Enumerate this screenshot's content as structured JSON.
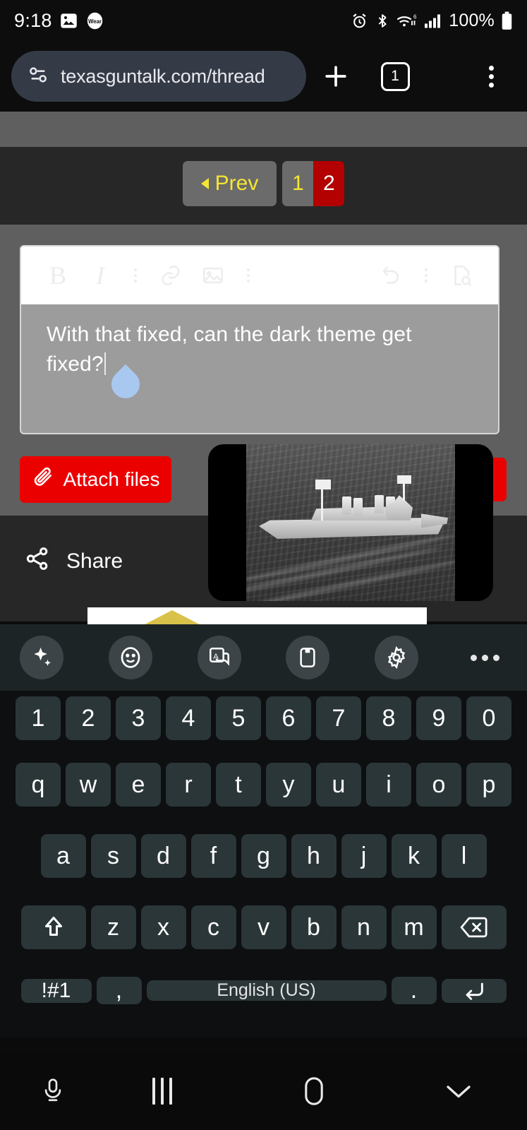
{
  "status_bar": {
    "clock": "9:18",
    "battery_percent": "100%",
    "icons": [
      "photos-icon",
      "wear-icon",
      "alarm-icon",
      "bluetooth-icon",
      "wifi-icon",
      "signal-icon",
      "battery-icon"
    ]
  },
  "browser": {
    "url": "texasguntalk.com/thread",
    "site_info_icon": "site-settings-icon",
    "new_tab_label": "+",
    "tab_count": "1",
    "menu_icon": "overflow-menu-icon"
  },
  "pagination": {
    "prev_label": "Prev",
    "pages": [
      {
        "label": "1",
        "active": false
      },
      {
        "label": "2",
        "active": true
      }
    ]
  },
  "editor": {
    "toolbar_icons": [
      "bold-icon",
      "italic-icon",
      "divider",
      "link-icon",
      "image-icon",
      "divider",
      "undo-icon",
      "divider",
      "preview-icon"
    ],
    "bold_label": "B",
    "italic_label": "I",
    "message_text": "With that fixed, can the dark theme get fixed?",
    "cursor_handle": "text-cursor-handle"
  },
  "actions": {
    "attach_label": "Attach files",
    "attach_icon": "paperclip-icon",
    "share_label": "Share",
    "share_icon": "share-icon"
  },
  "overlay_image": {
    "name": "warship-photo",
    "description": "Black and white aerial photo of a naval cruiser underway at sea"
  },
  "keyboard_toolbar": {
    "buttons": [
      {
        "name": "ai-sparkle-icon"
      },
      {
        "name": "emoji-icon"
      },
      {
        "name": "translate-icon"
      },
      {
        "name": "clipboard-icon"
      },
      {
        "name": "settings-gear-icon"
      },
      {
        "name": "more-options-icon"
      }
    ]
  },
  "keyboard": {
    "row1": [
      "1",
      "2",
      "3",
      "4",
      "5",
      "6",
      "7",
      "8",
      "9",
      "0"
    ],
    "row2": [
      "q",
      "w",
      "e",
      "r",
      "t",
      "y",
      "u",
      "i",
      "o",
      "p"
    ],
    "row3": [
      "a",
      "s",
      "d",
      "f",
      "g",
      "h",
      "j",
      "k",
      "l"
    ],
    "row4": [
      "z",
      "x",
      "c",
      "v",
      "b",
      "n",
      "m"
    ],
    "shift_icon": "shift-icon",
    "backspace_icon": "backspace-icon",
    "symbols_label": "!#1",
    "comma_label": ",",
    "space_label": "English (US)",
    "period_label": ".",
    "enter_icon": "enter-icon"
  },
  "nav_bar": {
    "mic_icon": "microphone-icon",
    "recents_icon": "recents-icon",
    "home_icon": "home-icon",
    "dismiss_icon": "dismiss-keyboard-icon"
  },
  "colors": {
    "accent_red": "#eb0000",
    "page_active_red": "#b30000",
    "link_yellow": "#f5e632",
    "editor_body_gray": "#9c9c9c",
    "cursor_blue": "#a8c8f0"
  }
}
